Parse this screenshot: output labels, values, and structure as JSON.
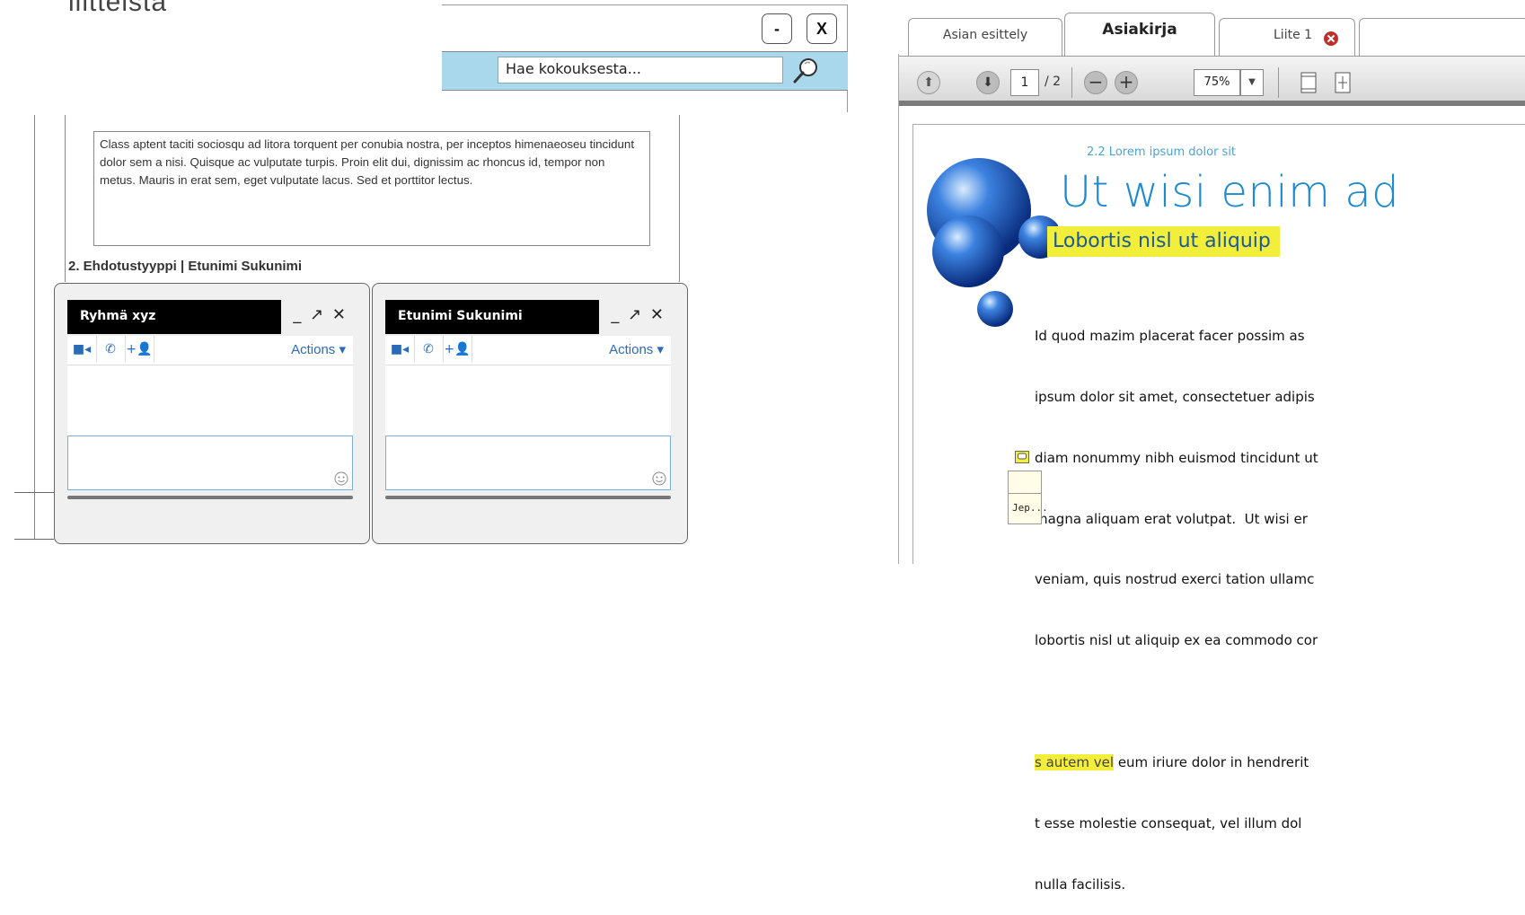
{
  "top_title": "liitteistä",
  "search_window": {
    "minimize_label": "-",
    "close_label": "X",
    "search_value": "Hae kokouksesta..."
  },
  "document": {
    "paragraph": "Class aptent taciti sociosqu ad litora torquent per conubia nostra, per inceptos himenaeoseu tincidunt dolor sem a nisi. Quisque ac vulputate turpis. Proin elit dui, dignissim ac rhoncus id, tempor non metus. Mauris in erat sem, eget vulputate lacus. Sed et porttitor lectus.",
    "section_heading": "2. Ehdotustyyppi | Etunimi Sukunimi"
  },
  "chats": [
    {
      "title": "Ryhmä xyz",
      "controls": "_ ↗ ✕",
      "actions_label": "Actions ▾"
    },
    {
      "title": "Etunimi Sukunimi",
      "controls": "_ ↗ ✕",
      "actions_label": "Actions ▾"
    }
  ],
  "viewer": {
    "tabs": [
      "Asian esittely",
      "Asiakirja",
      "Liite 1"
    ],
    "active_tab": "Asiakirja",
    "page_current": "1",
    "page_total": "/ 2",
    "zoom": "75%",
    "accent_color": "#1e8ad0",
    "highlight_color": "#f2ee3a"
  },
  "page_content": {
    "subheading": "2.2 Lorem ipsum dolor sit",
    "title": "Ut wisi enim ad",
    "highlight_title": "Lobortis nisl ut aliquip",
    "lines": [
      "Id quod mazim placerat facer possim as",
      "ipsum dolor sit amet, consectetuer adipis",
      "diam nonummy nibh euismod tincidunt ut",
      "magna aliquam erat volutpat.  Ut wisi er",
      "veniam, quis nostrud exerci tation ullamc",
      "lobortis nisl ut aliquip ex ea commodo cor"
    ],
    "line7_highlight": "s autem vel",
    "line7_rest": " eum iriure dolor in hendrerit",
    "line8": "t esse molestie consequat, vel illum dol",
    "line9": "nulla facilisis.",
    "note_text": "Jep..."
  }
}
